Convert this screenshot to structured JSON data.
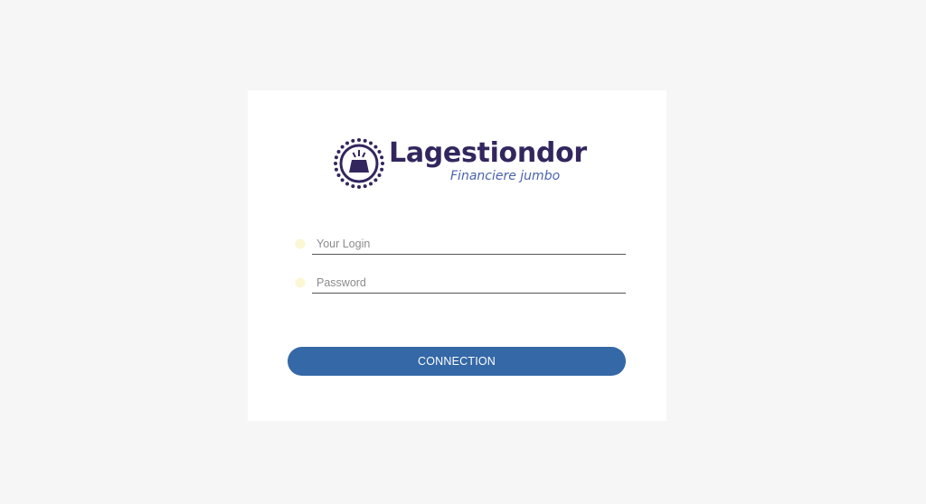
{
  "brand": {
    "title": "Lagestiondor",
    "subtitle": "Financiere jumbo",
    "emblem_icon": "gold-bar-icon"
  },
  "login_form": {
    "login_placeholder": "Your Login",
    "login_value": "",
    "password_placeholder": "Password",
    "password_value": "",
    "submit_label": "CONNECTION"
  },
  "colors": {
    "page_background": "#f6f6f6",
    "card_background": "#ffffff",
    "brand_primary": "#33265e",
    "brand_secondary": "#4b62b0",
    "button": "#3468a6",
    "field_icon": "#fbf6d4"
  }
}
